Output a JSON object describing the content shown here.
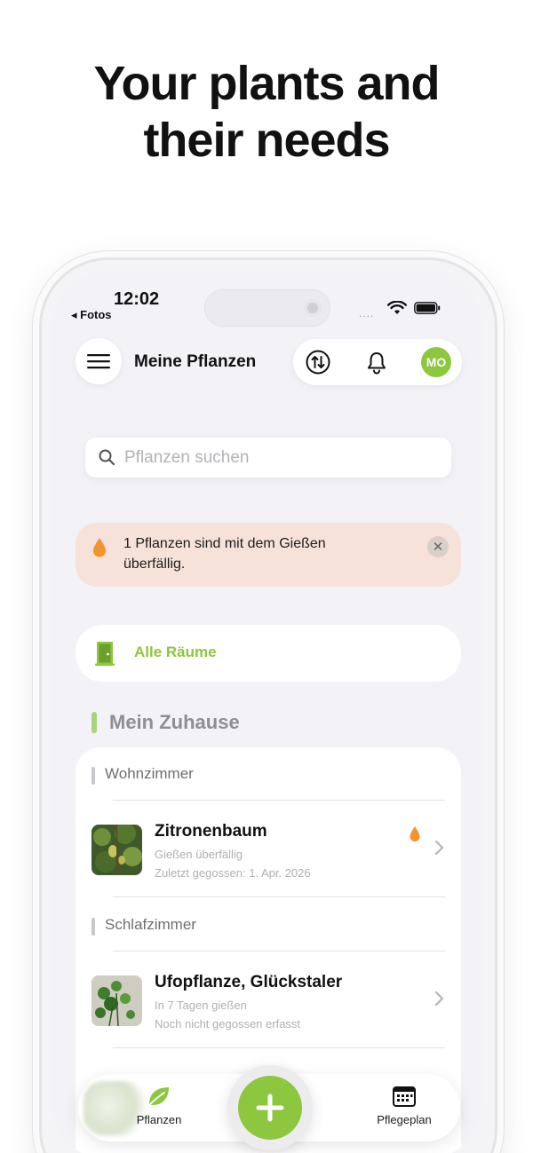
{
  "headline": {
    "line1": "Your plants and",
    "line2": "their needs"
  },
  "status_bar": {
    "time": "12:02",
    "back_app": "◂ Fotos",
    "signal": "....",
    "icons": [
      "wifi-icon",
      "battery-icon"
    ]
  },
  "header": {
    "title": "Meine Pflanzen",
    "avatar_initials": "MO",
    "icons": [
      "menu-icon",
      "sort-icon",
      "bell-icon"
    ]
  },
  "search": {
    "placeholder": "Pflanzen suchen"
  },
  "alert": {
    "text": "1 Pflanzen sind mit dem Gießen überfällig.",
    "close_glyph": "✕"
  },
  "rooms_filter": {
    "label": "Alle Räume"
  },
  "section": {
    "title": "Mein Zuhause"
  },
  "rooms": [
    {
      "name": "Wohnzimmer",
      "plants": [
        {
          "name": "Zitronenbaum",
          "status": "Gießen überfällig",
          "last_watered": "Zuletzt gegossen: 1. Apr. 2026",
          "overdue": true
        }
      ]
    },
    {
      "name": "Schlafzimmer",
      "plants": [
        {
          "name": "Ufopflanze, Glückstaler",
          "status": "In 7 Tagen gießen",
          "last_watered": "Noch nicht gegossen erfasst",
          "overdue": false
        }
      ]
    }
  ],
  "tabbar": {
    "tabs": [
      {
        "label": "Pflanzen",
        "icon": "leaf-icon",
        "active": true
      },
      {
        "label": "Pflegeplan",
        "icon": "calendar-icon",
        "active": false
      }
    ],
    "fab_icon": "plus-icon"
  },
  "colors": {
    "accent": "#8dc63f",
    "alert_bg": "#f7e2d9",
    "drop": "#f5932e",
    "background": "#f2f2f7"
  }
}
